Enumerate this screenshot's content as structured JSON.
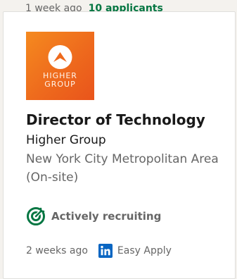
{
  "previous_job": {
    "posted": "1 week ago",
    "applicants": "10 applicants"
  },
  "job": {
    "logo": {
      "icon": "higher-group-logo",
      "line1": "HIGHER",
      "line2": "GROUP",
      "bg_color": "#ee6a1d"
    },
    "title": "Director of Technology",
    "company": "Higher Group",
    "location": "New York City Metropolitan Area (On-site)",
    "recruiting_status": "Actively recruiting",
    "recruiting_icon": "target-icon",
    "posted": "2 weeks ago",
    "apply_icon": "linkedin-icon",
    "apply_label": "Easy Apply"
  },
  "colors": {
    "accent_green": "#057642",
    "linkedin_blue": "#0a66c2",
    "text_primary": "#191919",
    "text_secondary": "#666666"
  }
}
